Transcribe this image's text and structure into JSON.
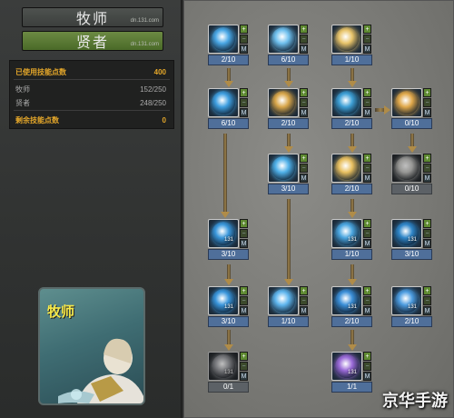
{
  "tabs": [
    {
      "name": "牧师",
      "site": "dn.131.com"
    },
    {
      "name": "贤者",
      "site": "dn.131.com"
    }
  ],
  "stats": {
    "used_label": "已使用技能点数",
    "used_value": "400",
    "priest_label": "牧师",
    "priest_value": "152/250",
    "sage_label": "贤者",
    "sage_value": "248/250",
    "remaining_label": "剩余技能点数",
    "remaining_value": "0"
  },
  "portrait": {
    "title": "牧师"
  },
  "buttons": {
    "plus": "+",
    "minus": "−",
    "max": "M"
  },
  "skills": [
    {
      "level": "2/10",
      "req": "",
      "color": "#4aa8e6",
      "icon": "holy-light-icon",
      "locked": false
    },
    {
      "level": "6/10",
      "req": "",
      "color": "#6fc0ee",
      "icon": "cross-icon",
      "locked": false
    },
    {
      "level": "1/10",
      "req": "",
      "color": "#e8c46a",
      "icon": "golden-cross-icon",
      "locked": false
    },
    {
      "level": "6/10",
      "req": "",
      "color": "#3f9fe0",
      "icon": "water-orb-icon",
      "locked": false
    },
    {
      "level": "2/10",
      "req": "",
      "color": "#d8a64a",
      "icon": "golden-figure-icon",
      "locked": false
    },
    {
      "level": "2/10",
      "req": "",
      "color": "#3ea0d6",
      "icon": "shield-orb-icon",
      "locked": false
    },
    {
      "level": "0/10",
      "req": "",
      "color": "#e0a84a",
      "icon": "sun-flare-icon",
      "locked": false
    },
    {
      "level": "3/10",
      "req": "",
      "color": "#4fb0e8",
      "icon": "light-pillar-icon",
      "locked": false
    },
    {
      "level": "2/10",
      "req": "",
      "color": "#e8c060",
      "icon": "golden-orb-icon",
      "locked": false
    },
    {
      "level": "0/10",
      "req": "",
      "color": "#c9c9c0",
      "icon": "silver-orb-icon",
      "locked": true
    },
    {
      "level": "3/10",
      "req": "131",
      "color": "#3a98dc",
      "icon": "lightning-orb-icon",
      "locked": false
    },
    {
      "level": "1/10",
      "req": "131",
      "color": "#4aa6e0",
      "icon": "spirit-orb-icon",
      "locked": false
    },
    {
      "level": "3/10",
      "req": "131",
      "color": "#2f86c8",
      "icon": "blue-circle-icon",
      "locked": false
    },
    {
      "level": "3/10",
      "req": "131",
      "color": "#3a96dc",
      "icon": "storm-orb-icon",
      "locked": false
    },
    {
      "level": "1/10",
      "req": "",
      "color": "#5fb6ee",
      "icon": "crescent-icon",
      "locked": false
    },
    {
      "level": "2/10",
      "req": "131",
      "color": "#3b8fd8",
      "icon": "wave-orb-icon",
      "locked": false
    },
    {
      "level": "2/10",
      "req": "131",
      "color": "#4c9ce0",
      "icon": "ring-orb-icon",
      "locked": false
    },
    {
      "level": "0/1",
      "req": "131",
      "color": "#9aa0b0",
      "icon": "white-wing-icon",
      "locked": true
    },
    {
      "level": "1/1",
      "req": "131",
      "color": "#9a6ad8",
      "icon": "violet-orb-icon",
      "locked": false
    }
  ],
  "watermark": "京华手游"
}
